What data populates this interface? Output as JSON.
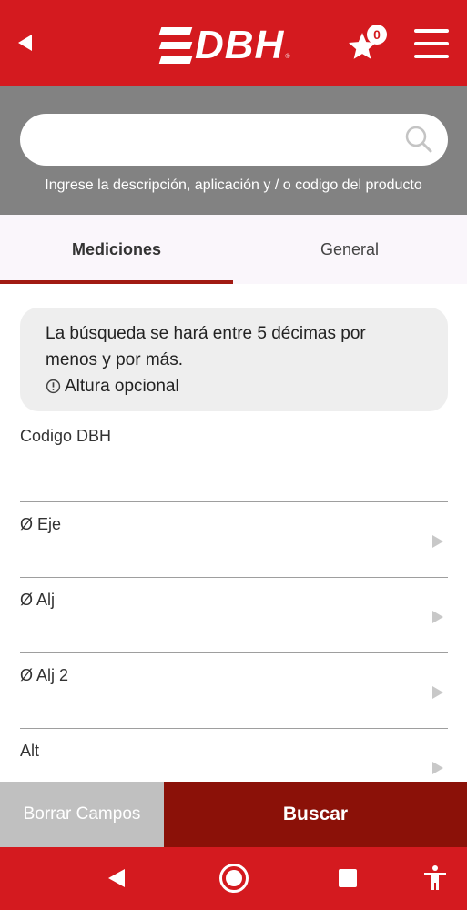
{
  "header": {
    "logo_text": "DBH",
    "logo_mark": "®",
    "favorites_count": "0",
    "icons": {
      "back": "back-arrow-icon",
      "favorites": "star-icon",
      "menu": "hamburger-menu-icon"
    }
  },
  "search": {
    "placeholder": "",
    "hint": "Ingrese la descripción, aplicación y / o codigo del producto",
    "icon": "search-icon"
  },
  "tabs": [
    {
      "label": "Mediciones",
      "active": true
    },
    {
      "label": "General",
      "active": false
    }
  ],
  "info": {
    "line1": "La búsqueda se hará entre 5 décimas por menos y por más.",
    "line2": "Altura opcional"
  },
  "fields": [
    {
      "label": "Codigo DBH",
      "has_arrow": false
    },
    {
      "label": "Ø Eje",
      "has_arrow": true
    },
    {
      "label": "Ø Alj",
      "has_arrow": true
    },
    {
      "label": "Ø Alj 2",
      "has_arrow": true
    },
    {
      "label": "Alt",
      "has_arrow": true
    }
  ],
  "actions": {
    "clear_label": "Borrar Campos",
    "search_label": "Buscar"
  },
  "colors": {
    "brand_red": "#d41a1f",
    "dark_red": "#8b1108",
    "grey": "#828282"
  }
}
